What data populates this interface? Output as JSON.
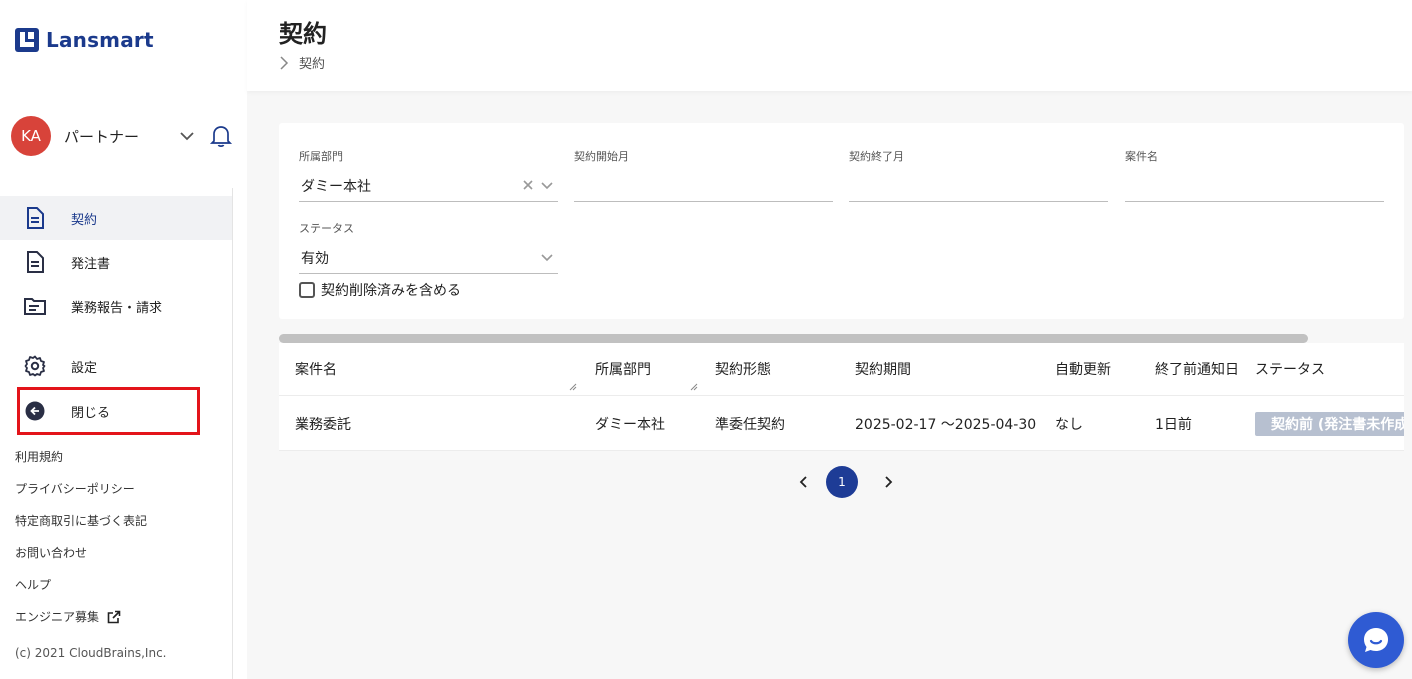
{
  "brand": {
    "name": "Lansmart"
  },
  "user": {
    "initials": "KA",
    "name": "パートナー"
  },
  "nav": {
    "items": [
      {
        "label": "契約"
      },
      {
        "label": "発注書"
      },
      {
        "label": "業務報告・請求"
      },
      {
        "label": "設定"
      }
    ],
    "close_label": "閉じる"
  },
  "footer": {
    "links": [
      "利用規約",
      "プライバシーポリシー",
      "特定商取引に基づく表記",
      "お問い合わせ",
      "ヘルプ",
      "エンジニア募集"
    ],
    "copyright": "(c) 2021 CloudBrains,Inc."
  },
  "header": {
    "title": "契約",
    "breadcrumb": "契約"
  },
  "filters": {
    "department": {
      "label": "所属部門",
      "value": "ダミー本社"
    },
    "start_month": {
      "label": "契約開始月",
      "value": ""
    },
    "end_month": {
      "label": "契約終了月",
      "value": ""
    },
    "project_name": {
      "label": "案件名",
      "value": ""
    },
    "status": {
      "label": "ステータス",
      "value": "有効"
    },
    "include_deleted": {
      "label": "契約削除済みを含める",
      "checked": false
    }
  },
  "table": {
    "columns": [
      "案件名",
      "所属部門",
      "契約形態",
      "契約期間",
      "自動更新",
      "終了前通知日",
      "ステータス"
    ],
    "rows": [
      [
        "業務委託",
        "ダミー本社",
        "準委任契約",
        "2025-02-17 〜2025-04-30",
        "なし",
        "1日前",
        "契約前 (発注書未作成)"
      ]
    ]
  },
  "pagination": {
    "current": "1"
  },
  "colors": {
    "brand": "#1b3a8c",
    "accent_red": "#e3141a",
    "avatar": "#d8433a",
    "page_active": "#1e3c96",
    "status_badge": "#b7c0d0"
  }
}
